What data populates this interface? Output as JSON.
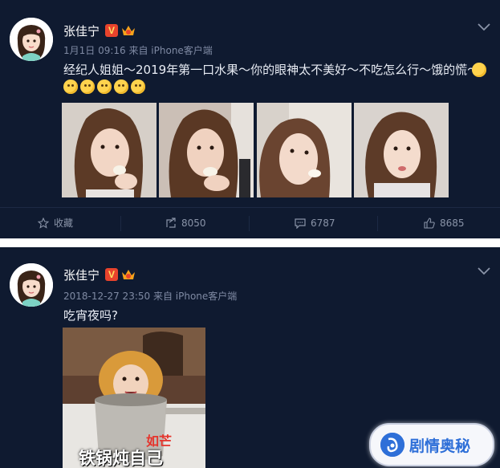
{
  "posts": [
    {
      "username": "张佳宁",
      "verified_badge": "V",
      "meta": "1月1日 09:16 来自 iPhone客户端",
      "text": "经纪人姐姐～2019年第一口水果～你的眼神太不美好～不吃怎么行～饿的慌～",
      "icons": [
        "avatar",
        "verified-icon",
        "crown-icon",
        "chevron-down-icon",
        "thinking-emoji"
      ],
      "emoji_count": 5,
      "photos": [
        "photo-1",
        "photo-2",
        "photo-3",
        "photo-4"
      ],
      "actions": {
        "favorite_label": "收藏",
        "repost_count": "8050",
        "comment_count": "6787",
        "like_count": "8685"
      }
    },
    {
      "username": "张佳宁",
      "verified_badge": "V",
      "meta": "2018-12-27 23:50 来自 iPhone客户端",
      "text": "吃宵夜吗?",
      "image_caption_main": "铁锅炖自己",
      "image_caption_overlay": "如芒"
    }
  ],
  "watermark": {
    "text": "剧情奥秘"
  },
  "colors": {
    "background": "#0f1a30",
    "separator": "#ffffff",
    "meta_text": "#7f8aa3",
    "body_text": "#e8ecf4",
    "badge_red": "#e8432c",
    "watermark_blue": "#2e6fd8"
  }
}
